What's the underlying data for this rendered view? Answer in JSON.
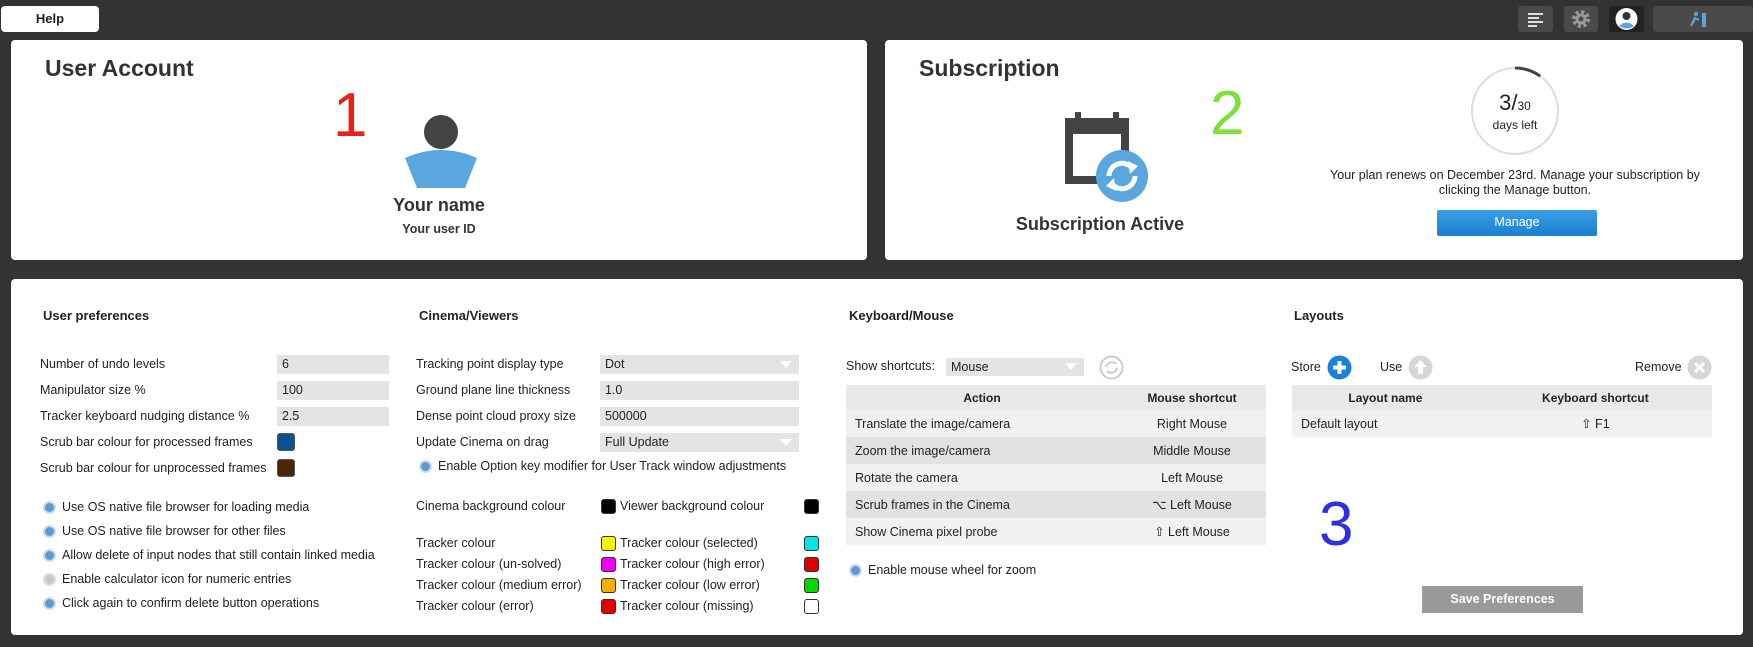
{
  "topbar": {
    "help_label": "Help"
  },
  "user_account": {
    "title": "User Account",
    "number": "1",
    "name": "Your name",
    "user_id": "Your user ID"
  },
  "subscription": {
    "title": "Subscription",
    "number": "2",
    "status": "Subscription Active",
    "days_used": "3/",
    "days_total": "30",
    "days_caption": "days left",
    "days_progress": 0.1,
    "renew_line1": "Your plan renews on December 23rd. Manage your subscription by",
    "renew_line2": "clicking the Manage button.",
    "manage_label": "Manage"
  },
  "user_prefs": {
    "title": "User preferences",
    "fields": [
      {
        "label": "Number of undo levels",
        "value": "6"
      },
      {
        "label": "Manipulator size %",
        "value": "100"
      },
      {
        "label": "Tracker keyboard nudging distance %",
        "value": "2.5"
      }
    ],
    "scrub_processed_label": "Scrub bar colour for processed frames",
    "scrub_processed_color": "#0d4f8f",
    "scrub_unprocessed_label": "Scrub bar colour for unprocessed frames",
    "scrub_unprocessed_color": "#4a2508",
    "options": [
      {
        "label": "Use OS native file browser for loading media",
        "on": true
      },
      {
        "label": "Use OS native file browser for other files",
        "on": true
      },
      {
        "label": "Allow delete of input nodes that still contain linked media",
        "on": true
      },
      {
        "label": "Enable calculator icon for numeric entries",
        "on": false
      },
      {
        "label": "Click again to confirm delete button operations",
        "on": true
      }
    ]
  },
  "cinema": {
    "title": "Cinema/Viewers",
    "tracking_point_label": "Tracking point display type",
    "tracking_point_value": "Dot",
    "ground_plane_label": "Ground plane line thickness",
    "ground_plane_value": "1.0",
    "dense_cloud_label": "Dense point cloud proxy size",
    "dense_cloud_value": "500000",
    "update_cinema_label": "Update Cinema on drag",
    "update_cinema_value": "Full Update",
    "option_key_label": "Enable Option key modifier for User Track window adjustments",
    "cinema_bg_label": "Cinema background colour",
    "cinema_bg_color": "#000000",
    "viewer_bg_label": "Viewer background colour",
    "viewer_bg_color": "#000000",
    "trackers": [
      {
        "left_label": "Tracker colour",
        "left_color": "#f5f500",
        "right_label": "Tracker colour (selected)",
        "right_color": "#00e5e5"
      },
      {
        "left_label": "Tracker colour (un-solved)",
        "left_color": "#ee00ee",
        "right_label": "Tracker colour (high error)",
        "right_color": "#e00000"
      },
      {
        "left_label": "Tracker colour (medium error)",
        "left_color": "#f0b000",
        "right_label": "Tracker colour (low error)",
        "right_color": "#00d800"
      },
      {
        "left_label": "Tracker colour (error)",
        "left_color": "#e00000",
        "right_label": "Tracker colour (missing)",
        "right_color": "#ffffff"
      }
    ]
  },
  "keyboard": {
    "title": "Keyboard/Mouse",
    "show_label": "Show shortcuts:",
    "show_value": "Mouse",
    "col_action": "Action",
    "col_shortcut": "Mouse shortcut",
    "rows": [
      {
        "action": "Translate the image/camera",
        "shortcut": "Right Mouse"
      },
      {
        "action": "Zoom the image/camera",
        "shortcut": "Middle Mouse"
      },
      {
        "action": "Rotate the camera",
        "shortcut": "Left Mouse"
      },
      {
        "action": "Scrub frames in the Cinema",
        "shortcut": "⌥ Left Mouse"
      },
      {
        "action": "Show Cinema pixel probe",
        "shortcut": "⇧ Left Mouse"
      }
    ],
    "wheel_label": "Enable mouse wheel for zoom"
  },
  "layouts": {
    "title": "Layouts",
    "store_label": "Store",
    "use_label": "Use",
    "remove_label": "Remove",
    "col_name": "Layout name",
    "col_shortcut": "Keyboard shortcut",
    "rows": [
      {
        "name": "Default layout",
        "shortcut": "⇧ F1"
      }
    ],
    "number": "3",
    "save_label": "Save Preferences"
  },
  "colors": {
    "num1": "#e2231a",
    "num2": "#7ee03a",
    "num3": "#2f2fe0",
    "accent": "#5b9bd5",
    "icon_blue": "#5aa7e0"
  }
}
